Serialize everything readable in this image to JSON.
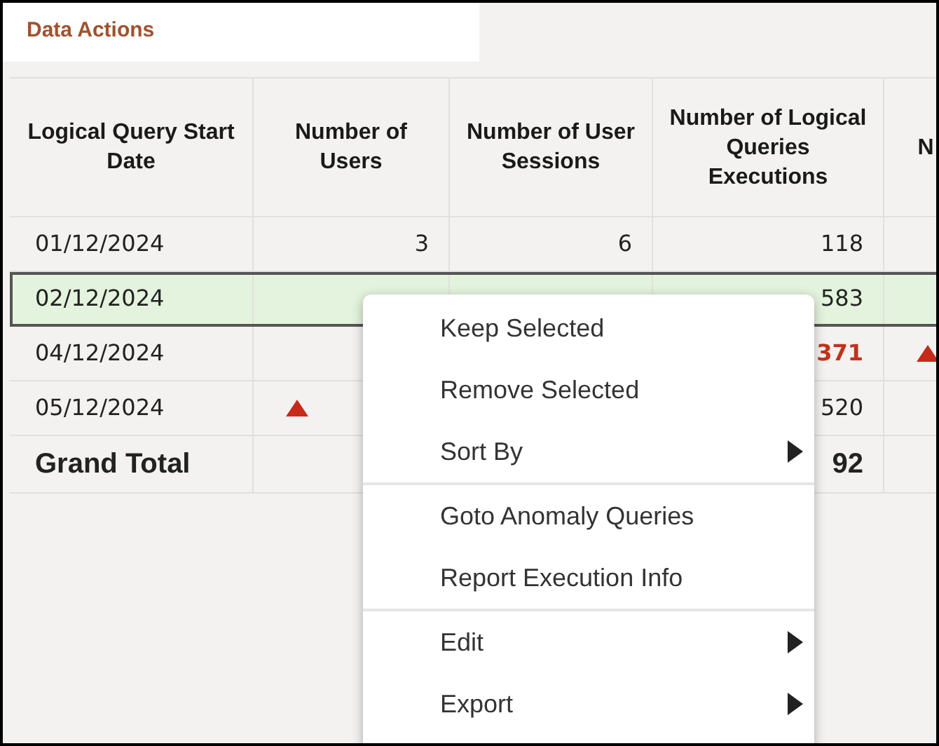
{
  "title": "Data Actions",
  "table": {
    "columns": [
      "Logical Query Start Date",
      "Number of Users",
      "Number of User Sessions",
      "Number of Logical Queries Executions",
      "N"
    ],
    "rows": [
      {
        "kind": "data",
        "selected": false,
        "cells": [
          {
            "kind": "text",
            "text": "01/12/2024"
          },
          {
            "kind": "text",
            "text": "3"
          },
          {
            "kind": "text",
            "text": "6"
          },
          {
            "kind": "text",
            "text": "118"
          },
          {
            "kind": "blank"
          }
        ]
      },
      {
        "kind": "data",
        "selected": true,
        "cells": [
          {
            "kind": "text",
            "text": "02/12/2024"
          },
          {
            "kind": "blank"
          },
          {
            "kind": "blank"
          },
          {
            "kind": "text",
            "text": "583"
          },
          {
            "kind": "blank"
          }
        ]
      },
      {
        "kind": "data",
        "selected": false,
        "cells": [
          {
            "kind": "text",
            "text": "04/12/2024"
          },
          {
            "kind": "blank"
          },
          {
            "kind": "blank"
          },
          {
            "kind": "alert",
            "text": "371"
          },
          {
            "kind": "trend_up"
          }
        ]
      },
      {
        "kind": "data",
        "selected": false,
        "cells": [
          {
            "kind": "text",
            "text": "05/12/2024"
          },
          {
            "kind": "trend_up"
          },
          {
            "kind": "blank"
          },
          {
            "kind": "text",
            "text": "520"
          },
          {
            "kind": "blank"
          }
        ]
      },
      {
        "kind": "total",
        "selected": false,
        "cells": [
          {
            "kind": "text",
            "text": "Grand Total"
          },
          {
            "kind": "blank"
          },
          {
            "kind": "blank"
          },
          {
            "kind": "text",
            "text": "92"
          },
          {
            "kind": "blank"
          }
        ]
      }
    ]
  },
  "context_menu": {
    "groups": [
      [
        {
          "label": "Keep Selected",
          "submenu": false
        },
        {
          "label": "Remove Selected",
          "submenu": false
        },
        {
          "label": "Sort By",
          "submenu": true
        }
      ],
      [
        {
          "label": "Goto Anomaly Queries",
          "submenu": false
        },
        {
          "label": "Report Execution Info",
          "submenu": false
        }
      ],
      [
        {
          "label": "Edit",
          "submenu": true
        },
        {
          "label": "Export",
          "submenu": true
        }
      ]
    ]
  }
}
